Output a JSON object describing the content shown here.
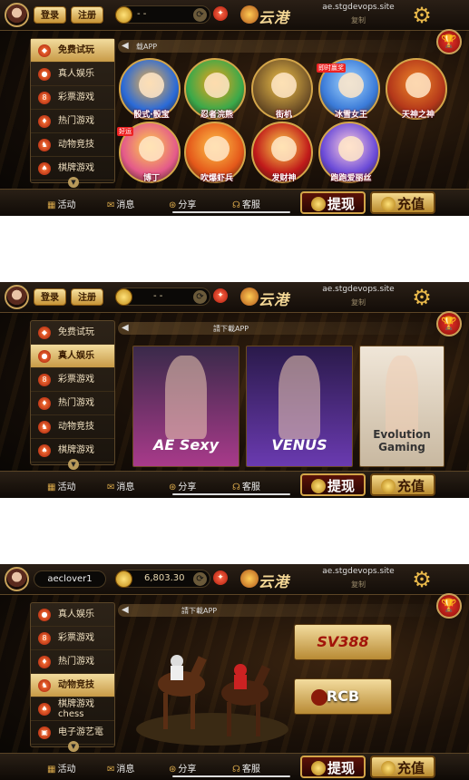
{
  "screens": [
    {
      "top": {
        "login": "登录",
        "register": "注册",
        "balance": "- -",
        "site": "ae.stgdevops.site",
        "copy": "复制",
        "logo_text": "云港"
      },
      "notice": "载APP",
      "sidebar": [
        {
          "label": "免费试玩",
          "active": true
        },
        {
          "label": "真人娱乐"
        },
        {
          "label": "彩票游戏"
        },
        {
          "label": "热门游戏"
        },
        {
          "label": "动物竞技"
        },
        {
          "label": "棋牌游戏"
        }
      ],
      "games": [
        {
          "label": "骰式·骰宝",
          "colors": [
            "#2a6ad8",
            "#f0b24a"
          ]
        },
        {
          "label": "忍者浣熊",
          "colors": [
            "#3aa94a",
            "#f4a21a"
          ]
        },
        {
          "label": "街机",
          "colors": [
            "#7a5a2a",
            "#f0c24a"
          ]
        },
        {
          "label": "冰雪女王",
          "colors": [
            "#3a7ad8",
            "#a6d8ff"
          ],
          "badge": "即时赢奖"
        },
        {
          "label": "天神之神",
          "colors": [
            "#b4381a",
            "#f08a2a"
          ]
        },
        {
          "label": "博丁",
          "colors": [
            "#e45a8a",
            "#ffd24a"
          ],
          "badge": "好运"
        },
        {
          "label": "吹爆虾兵",
          "colors": [
            "#e4581a",
            "#ffc44a"
          ]
        },
        {
          "label": "发财神",
          "colors": [
            "#c01a1a",
            "#ffd24a"
          ]
        },
        {
          "label": "跑跑爱丽丝",
          "colors": [
            "#6a4ad8",
            "#ffd0e0"
          ]
        }
      ],
      "bottom": {
        "activity": "活动",
        "message": "消息",
        "share": "分享",
        "service": "客服",
        "withdraw": "提现",
        "deposit": "充值"
      }
    },
    {
      "top": {
        "login": "登录",
        "register": "注册",
        "balance": "- -",
        "site": "ae.stgdevops.site",
        "copy": "复制",
        "logo_text": "云港"
      },
      "notice": "請下載APP",
      "sidebar": [
        {
          "label": "免费试玩"
        },
        {
          "label": "真人娱乐",
          "active": true
        },
        {
          "label": "彩票游戏"
        },
        {
          "label": "热门游戏"
        },
        {
          "label": "动物竞技"
        },
        {
          "label": "棋牌游戏"
        }
      ],
      "live": [
        {
          "label": "AE Sexy",
          "colors": [
            "#3a2a4a",
            "#a83a8a"
          ]
        },
        {
          "label": "VENUS",
          "colors": [
            "#2a1a4a",
            "#6a3ab0"
          ]
        },
        {
          "label": "Evolution Gaming",
          "colors": [
            "#f0e6d8",
            "#c8b8a0"
          ]
        }
      ],
      "bottom": {
        "activity": "活动",
        "message": "消息",
        "share": "分享",
        "service": "客服",
        "withdraw": "提现",
        "deposit": "充值"
      }
    },
    {
      "top": {
        "user": "aeclover1",
        "balance": "6,803.30",
        "site": "ae.stgdevops.site",
        "copy": "复制",
        "logo_text": "云港"
      },
      "notice": "請下載APP",
      "sidebar": [
        {
          "label": "真人娱乐"
        },
        {
          "label": "彩票游戏"
        },
        {
          "label": "热门游戏"
        },
        {
          "label": "动物竞技",
          "active": true
        },
        {
          "label": "棋牌游戏 chess"
        },
        {
          "label": "电子游艺電"
        }
      ],
      "race": {
        "brands": [
          "SV388",
          "RCB"
        ]
      },
      "bottom": {
        "activity": "活动",
        "message": "消息",
        "share": "分享",
        "service": "客服",
        "withdraw": "提现",
        "deposit": "充值"
      }
    }
  ]
}
